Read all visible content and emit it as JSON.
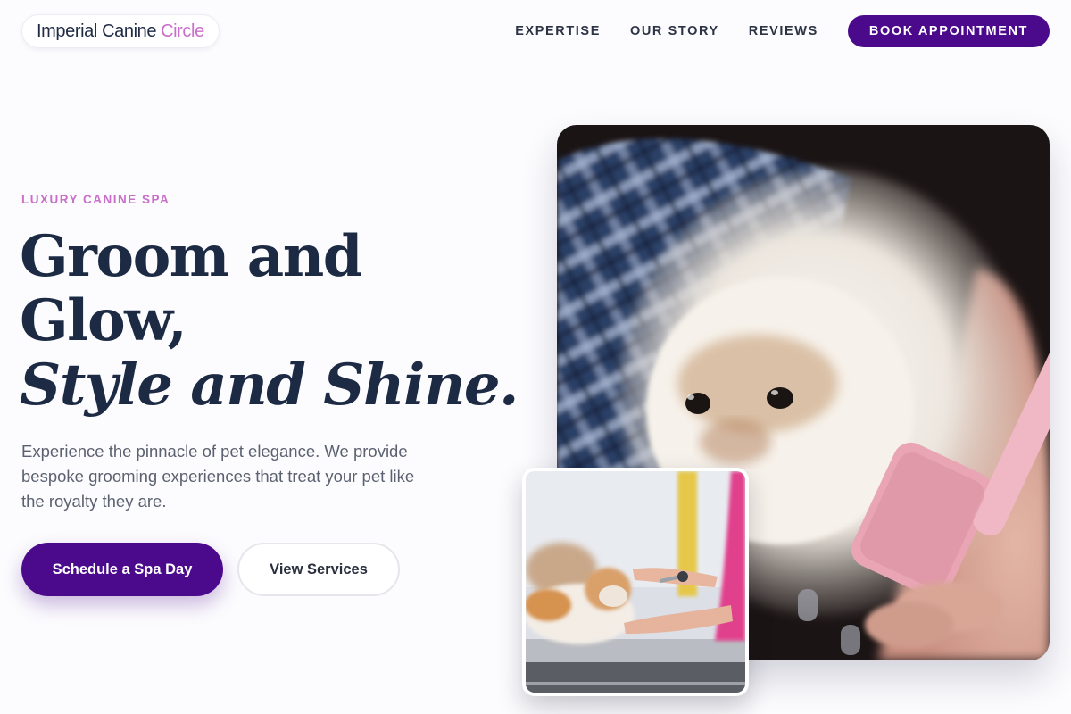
{
  "brand": {
    "name_main": "Imperial Canine",
    "name_accent": "Circle",
    "accent_color": "#c86fc9",
    "primary_color": "#4b0a8c"
  },
  "nav": {
    "links": [
      "EXPERTISE",
      "OUR STORY",
      "REVIEWS"
    ],
    "cta": "BOOK APPOINTMENT"
  },
  "hero": {
    "eyebrow": "LUXURY CANINE SPA",
    "headline_line1": "Groom and",
    "headline_line2": "Glow,",
    "headline_line3": "Style and Shine.",
    "lede": "Experience the pinnacle of pet elegance. We provide bespoke grooming experiences that treat your pet like the royalty they are.",
    "primary_button": "Schedule a Spa Day",
    "secondary_button": "View Services"
  }
}
